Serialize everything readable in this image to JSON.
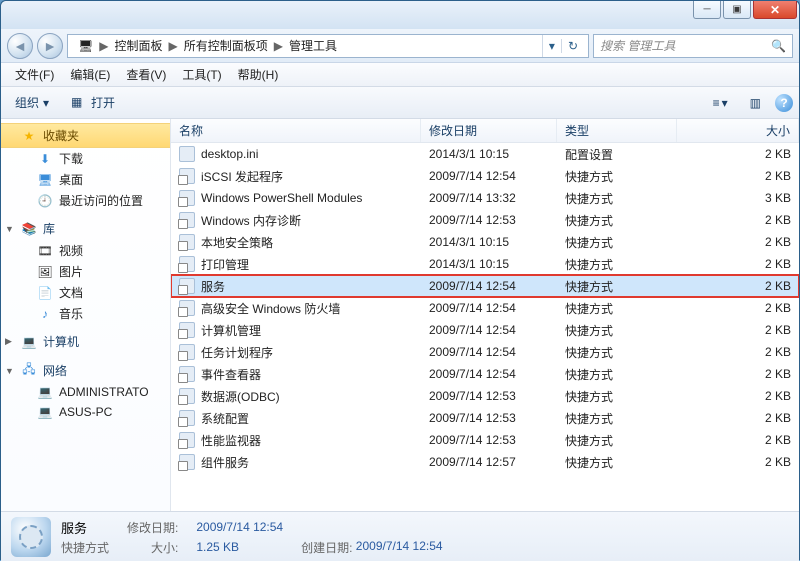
{
  "window": {
    "min": "─",
    "max": "▣",
    "close": "✕"
  },
  "breadcrumb": {
    "root_icon": "folder-icon",
    "items": [
      "控制面板",
      "所有控制面板项",
      "管理工具"
    ],
    "sep": "▶"
  },
  "search": {
    "placeholder": "搜索 管理工具"
  },
  "menubar": [
    "文件(F)",
    "编辑(E)",
    "查看(V)",
    "工具(T)",
    "帮助(H)"
  ],
  "toolbar": {
    "organize": "组织",
    "open": "打开",
    "dd": "▾",
    "view_icon": "≡",
    "help": "?"
  },
  "sidebar": {
    "favorites": {
      "label": "收藏夹",
      "items": [
        {
          "icon": "download-icon",
          "label": "下载"
        },
        {
          "icon": "desktop-icon",
          "label": "桌面"
        },
        {
          "icon": "recent-icon",
          "label": "最近访问的位置"
        }
      ]
    },
    "libraries": {
      "label": "库",
      "items": [
        {
          "icon": "video-icon",
          "label": "视频"
        },
        {
          "icon": "picture-icon",
          "label": "图片"
        },
        {
          "icon": "document-icon",
          "label": "文档"
        },
        {
          "icon": "music-icon",
          "label": "音乐"
        }
      ]
    },
    "computer": {
      "label": "计算机",
      "items": []
    },
    "network": {
      "label": "网络",
      "items": [
        {
          "icon": "pc-icon",
          "label": "ADMINISTRATO"
        },
        {
          "icon": "pc-icon",
          "label": "ASUS-PC"
        }
      ]
    }
  },
  "columns": {
    "name": "名称",
    "date": "修改日期",
    "type": "类型",
    "size": "大小"
  },
  "files": [
    {
      "name": "desktop.ini",
      "date": "2014/3/1 10:15",
      "type": "配置设置",
      "size": "2 KB",
      "lnk": false
    },
    {
      "name": "iSCSI 发起程序",
      "date": "2009/7/14 12:54",
      "type": "快捷方式",
      "size": "2 KB",
      "lnk": true
    },
    {
      "name": "Windows PowerShell Modules",
      "date": "2009/7/14 13:32",
      "type": "快捷方式",
      "size": "3 KB",
      "lnk": true
    },
    {
      "name": "Windows 内存诊断",
      "date": "2009/7/14 12:53",
      "type": "快捷方式",
      "size": "2 KB",
      "lnk": true
    },
    {
      "name": "本地安全策略",
      "date": "2014/3/1 10:15",
      "type": "快捷方式",
      "size": "2 KB",
      "lnk": true
    },
    {
      "name": "打印管理",
      "date": "2014/3/1 10:15",
      "type": "快捷方式",
      "size": "2 KB",
      "lnk": true
    },
    {
      "name": "服务",
      "date": "2009/7/14 12:54",
      "type": "快捷方式",
      "size": "2 KB",
      "lnk": true,
      "selected": true,
      "highlight": true
    },
    {
      "name": "高级安全 Windows 防火墙",
      "date": "2009/7/14 12:54",
      "type": "快捷方式",
      "size": "2 KB",
      "lnk": true
    },
    {
      "name": "计算机管理",
      "date": "2009/7/14 12:54",
      "type": "快捷方式",
      "size": "2 KB",
      "lnk": true
    },
    {
      "name": "任务计划程序",
      "date": "2009/7/14 12:54",
      "type": "快捷方式",
      "size": "2 KB",
      "lnk": true
    },
    {
      "name": "事件查看器",
      "date": "2009/7/14 12:54",
      "type": "快捷方式",
      "size": "2 KB",
      "lnk": true
    },
    {
      "name": "数据源(ODBC)",
      "date": "2009/7/14 12:53",
      "type": "快捷方式",
      "size": "2 KB",
      "lnk": true
    },
    {
      "name": "系统配置",
      "date": "2009/7/14 12:53",
      "type": "快捷方式",
      "size": "2 KB",
      "lnk": true
    },
    {
      "name": "性能监视器",
      "date": "2009/7/14 12:53",
      "type": "快捷方式",
      "size": "2 KB",
      "lnk": true
    },
    {
      "name": "组件服务",
      "date": "2009/7/14 12:57",
      "type": "快捷方式",
      "size": "2 KB",
      "lnk": true
    }
  ],
  "details": {
    "title": "服务",
    "subtitle": "快捷方式",
    "mod_label": "修改日期:",
    "mod_val": "2009/7/14 12:54",
    "size_label": "大小:",
    "size_val": "1.25 KB",
    "created_label": "创建日期:",
    "created_val": "2009/7/14 12:54"
  }
}
